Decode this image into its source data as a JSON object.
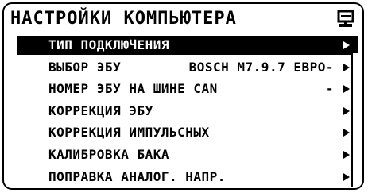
{
  "header": {
    "title": "НАСТРОЙКИ КОМПЬЮТЕРА",
    "icon": "computer-icon"
  },
  "menu": {
    "items": [
      {
        "label": "ТИП ПОДКЛЮЧЕНИЯ",
        "value": "",
        "selected": true
      },
      {
        "label": "ВЫБОР ЭБУ",
        "value": "BOSCH M7.9.7 ЕВРО-",
        "selected": false
      },
      {
        "label": "НОМЕР ЭБУ НА ШИНЕ CAN",
        "value": "-",
        "selected": false
      },
      {
        "label": "КОРРЕКЦИЯ ЭБУ",
        "value": "",
        "selected": false
      },
      {
        "label": "КОРРЕКЦИЯ ИМПУЛЬСНЫХ",
        "value": "",
        "selected": false
      },
      {
        "label": "КАЛИБРОВКА БАКА",
        "value": "",
        "selected": false
      },
      {
        "label": "ПОПРАВКА АНАЛОГ. НАПР.",
        "value": "",
        "selected": false
      }
    ]
  },
  "colors": {
    "foreground": "#000000",
    "background": "#ffffff"
  }
}
